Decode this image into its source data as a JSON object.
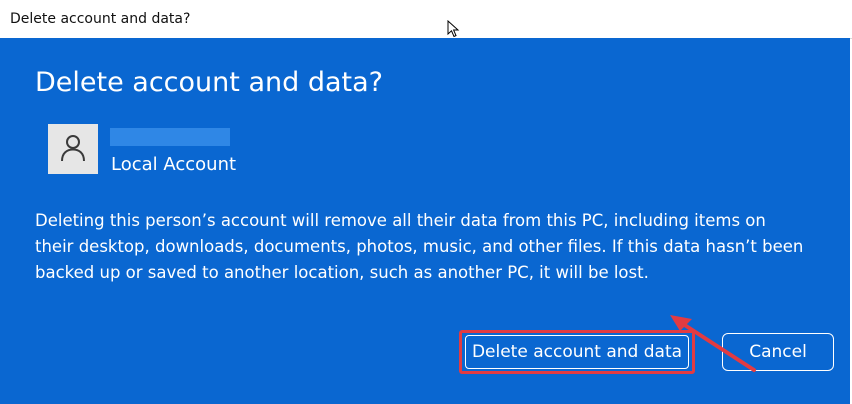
{
  "titlebar": {
    "title": "Delete account and data?"
  },
  "dialog": {
    "heading": "Delete account and data?",
    "account": {
      "avatar_icon": "user-icon",
      "name": "",
      "type": "Local Account"
    },
    "description": "Deleting this person’s account will remove all their data from this PC, including items on their desktop, downloads, documents, photos, music, and other files. If this data hasn’t been backed up or saved to another location, such as another PC, it will be lost.",
    "buttons": {
      "delete_label": "Delete account and data",
      "cancel_label": "Cancel"
    }
  },
  "colors": {
    "dialog_background": "#0a67d1",
    "annotation": "#e23b42"
  }
}
